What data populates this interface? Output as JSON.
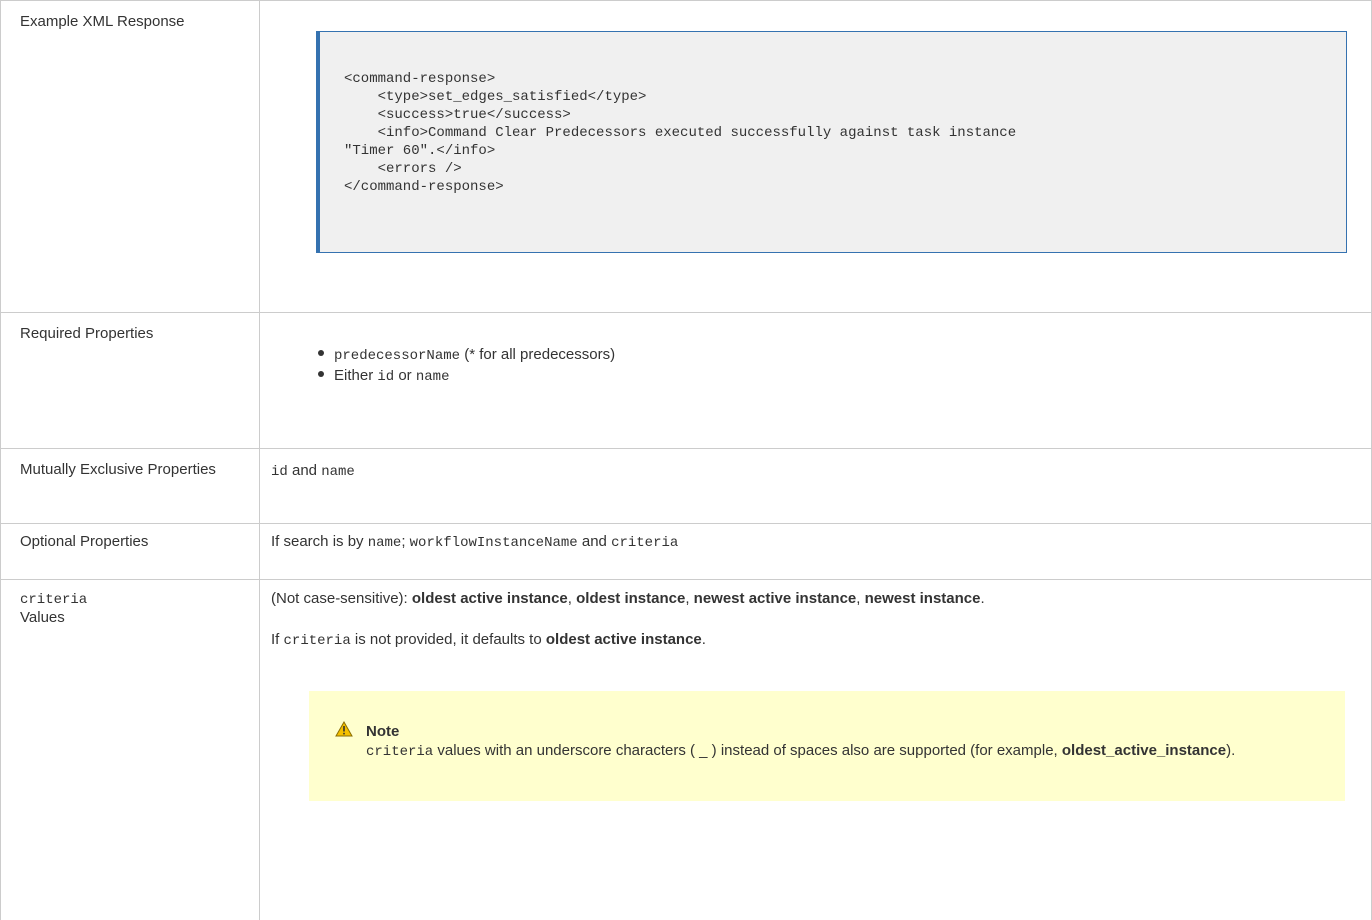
{
  "rows": {
    "xml": {
      "label": "Example XML Response",
      "code_lines": [
        "<command-response>",
        "    <type>set_edges_satisfied</type>",
        "    <success>true</success>",
        "    <info>Command Clear Predecessors executed successfully against task instance",
        "\"Timer 60\".</info>",
        "    <errors />",
        "</command-response>"
      ]
    },
    "required": {
      "label": "Required Properties",
      "item1_code": "predecessorName",
      "item1_text": " (* for all predecessors)",
      "item2_text1": "Either ",
      "item2_code1": "id",
      "item2_text2": " or ",
      "item2_code2": "name"
    },
    "mutual": {
      "label": "Mutually Exclusive Properties",
      "code1": "id",
      "text1": " and ",
      "code2": "name"
    },
    "optional": {
      "label": "Optional Properties",
      "text1": "If search is by ",
      "code1": "name",
      "text2": "; ",
      "code2": "workflowInstanceName",
      "text3": " and ",
      "code3": "criteria"
    },
    "criteria": {
      "label_code": "criteria",
      "label_text": "Values",
      "line1_prefix": "(Not case-sensitive): ",
      "values": [
        "oldest active instance",
        "oldest instance",
        "newest active instance",
        "newest instance"
      ],
      "sep": ", ",
      "end": ".",
      "line2_prefix": "If ",
      "line2_code": "criteria",
      "line2_mid": " is not provided, it defaults to ",
      "line2_bold": "oldest active instance",
      "line2_end": ".",
      "note": {
        "icon": "warning-icon",
        "title": "Note",
        "code": "criteria",
        "text": " values with an underscore characters ( _ ) instead of spaces also are supported (for example, ",
        "bold": "oldest_active_instance",
        "end": ")."
      }
    }
  },
  "colors": {
    "border": "#cccccc",
    "code_bg": "#f0f0f0",
    "code_border": "#3572b0",
    "note_bg": "#ffffce",
    "warning": "#f5c000"
  }
}
